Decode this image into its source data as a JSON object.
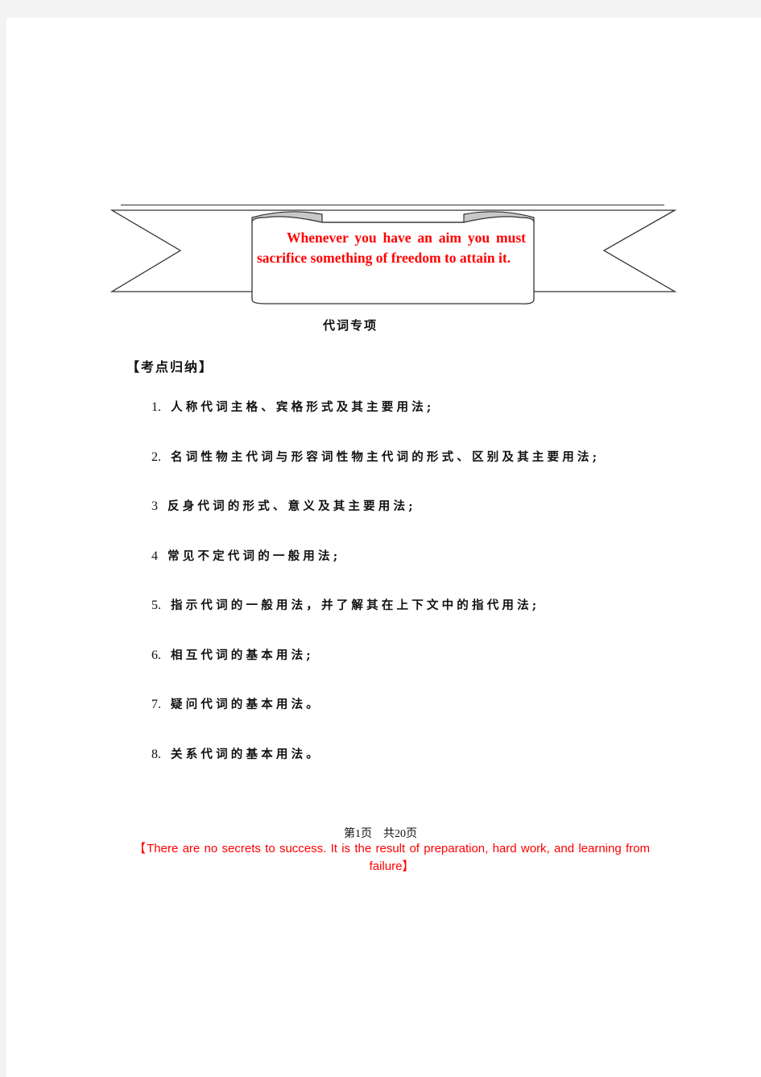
{
  "banner": {
    "quote": "Whenever you have an aim you must sacrifice something of freedom to attain it.",
    "text_color": "#ff0000"
  },
  "document": {
    "title": "代词专项",
    "section_heading": "【考点归纳】",
    "items": [
      {
        "number": "1.",
        "text": "人称代词主格、宾格形式及其主要用法;"
      },
      {
        "number": "2.",
        "text": "名词性物主代词与形容词性物主代词的形式、区别及其主要用法;"
      },
      {
        "number": "3",
        "text": "反身代词的形式、意义及其主要用法;"
      },
      {
        "number": "4",
        "text": "常见不定代词的一般用法;"
      },
      {
        "number": "5.",
        "text": "指示代词的一般用法，并了解其在上下文中的指代用法;"
      },
      {
        "number": "6.",
        "text": "相互代词的基本用法;"
      },
      {
        "number": "7.",
        "text": "疑问代词的基本用法。"
      },
      {
        "number": "8.",
        "text": "关系代词的基本用法。"
      }
    ]
  },
  "footer": {
    "page_indicator": "第1页　共20页",
    "quote": "【There are no secrets to success. It is the result of preparation, hard work, and learning from failure】",
    "quote_color": "#ff0000"
  }
}
